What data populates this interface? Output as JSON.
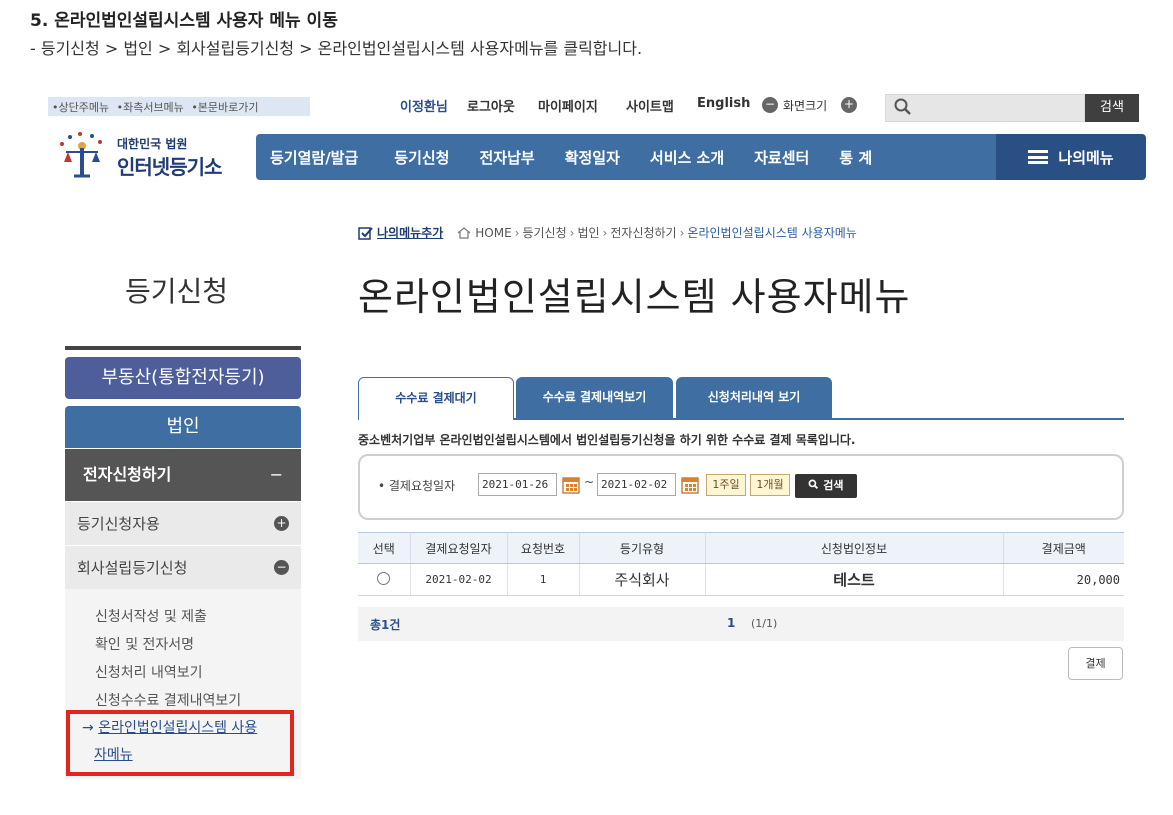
{
  "doc": {
    "title": "5. 온라인법인설립시스템 사용자 메뉴 이동",
    "desc": "- 등기신청 > 법인 > 회사설립등기신청 > 온라인법인설립시스템 사용자메뉴를 클릭합니다."
  },
  "utility": {
    "skip_links": [
      "•상단주메뉴",
      "•좌측서브메뉴",
      "•본문바로가기"
    ],
    "user_name": "이정환님",
    "logout": "로그아웃",
    "mypage": "마이페이지",
    "sitemap": "사이트맵",
    "english": "English",
    "zoom_label": "화면크기",
    "search_button": "검색"
  },
  "logo": {
    "small": "대한민국 법원",
    "big": "인터넷등기소"
  },
  "gnb": {
    "items": [
      "등기열람/발급",
      "등기신청",
      "전자납부",
      "확정일자",
      "서비스 소개",
      "자료센터",
      "통 계"
    ],
    "mymenu": "나의메뉴"
  },
  "breadcrumb": {
    "add_menu": "나의메뉴추가",
    "items": [
      "HOME",
      "등기신청",
      "법인",
      "전자신청하기"
    ],
    "current": "온라인법인설립시스템 사용자메뉴"
  },
  "titles": {
    "side": "등기신청",
    "page": "온라인법인설립시스템 사용자메뉴"
  },
  "sidebar": {
    "real_estate": "부동산(통합전자등기)",
    "corp": "법인",
    "esubmit": "전자신청하기",
    "esubmit_toggle": "−",
    "sub1": "등기신청자용",
    "sub2": "회사설립등기신청",
    "links": [
      "신청서작성 및 제출",
      "확인 및 전자서명",
      "신청처리 내역보기",
      "신청수수료 결제내역보기"
    ],
    "active_line1": "온라인법인설립시스템 사용",
    "active_line2": "자메뉴"
  },
  "tabs": [
    "수수료 결제대기",
    "수수료 결제내역보기",
    "신청처리내역 보기"
  ],
  "description": "중소벤처기업부 온라인법인설립시스템에서 법인설립등기신청을 하기 위한 수수료 결제 목록입니다.",
  "filter": {
    "label": "• 결제요청일자",
    "date_from": "2021-01-26",
    "date_to": "2021-02-02",
    "tilde": "~",
    "week": "1주일",
    "month": "1개월",
    "search": "검색"
  },
  "table": {
    "headers": [
      "선택",
      "결제요청일자",
      "요청번호",
      "등기유형",
      "신청법인정보",
      "결제금액"
    ],
    "rows": [
      {
        "date": "2021-02-02",
        "req_no": "1",
        "type": "주식회사",
        "corp": "테스트",
        "amount": "20,000"
      }
    ]
  },
  "pager": {
    "total": "총1건",
    "page": "1",
    "info": "(1/1)"
  },
  "pay_button": "결제"
}
